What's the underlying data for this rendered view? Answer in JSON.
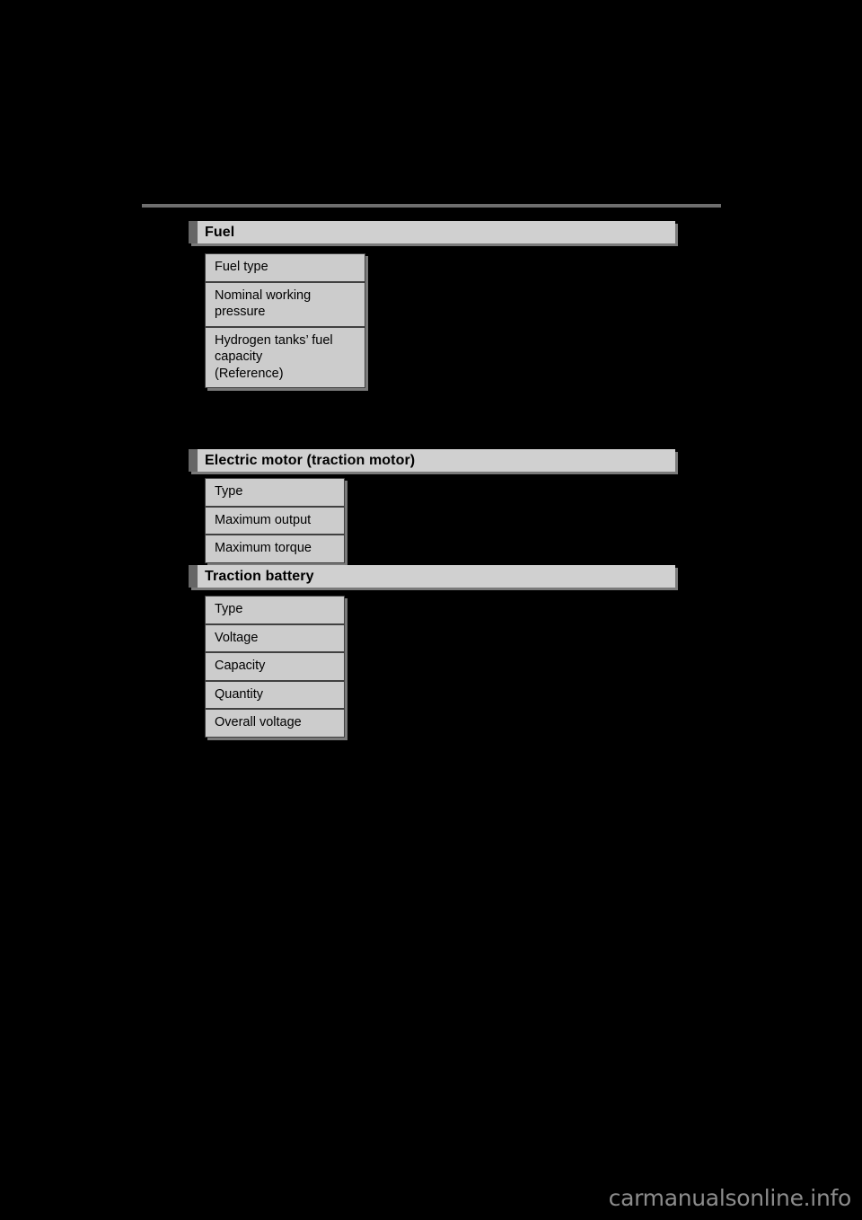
{
  "page": {
    "background_color": "#000000",
    "watermark": "carmanualsonline.info"
  },
  "sections": [
    {
      "id": "fuel",
      "title": "Fuel",
      "rows": [
        {
          "lines": [
            "Fuel type"
          ]
        },
        {
          "lines": [
            "Nominal working",
            "pressure"
          ]
        },
        {
          "lines": [
            "Hydrogen tanks’ fuel",
            "capacity",
            "(Reference)"
          ]
        }
      ]
    },
    {
      "id": "motor",
      "title": "Electric motor (traction motor)",
      "rows": [
        {
          "lines": [
            "Type"
          ]
        },
        {
          "lines": [
            "Maximum output"
          ]
        },
        {
          "lines": [
            "Maximum torque"
          ]
        }
      ]
    },
    {
      "id": "battery",
      "title": "Traction battery",
      "rows": [
        {
          "lines": [
            "Type"
          ]
        },
        {
          "lines": [
            "Voltage"
          ]
        },
        {
          "lines": [
            "Capacity"
          ]
        },
        {
          "lines": [
            "Quantity"
          ]
        },
        {
          "lines": [
            "Overall voltage"
          ]
        }
      ]
    }
  ],
  "colors": {
    "header_band": "#d0d0d0",
    "header_accent": "#666666",
    "cell_fill": "#cccccc",
    "cell_border": "#404040",
    "shadow": "#7a7a7a",
    "rule": "#6e6e6e",
    "watermark_text": "#8c8c8c"
  }
}
